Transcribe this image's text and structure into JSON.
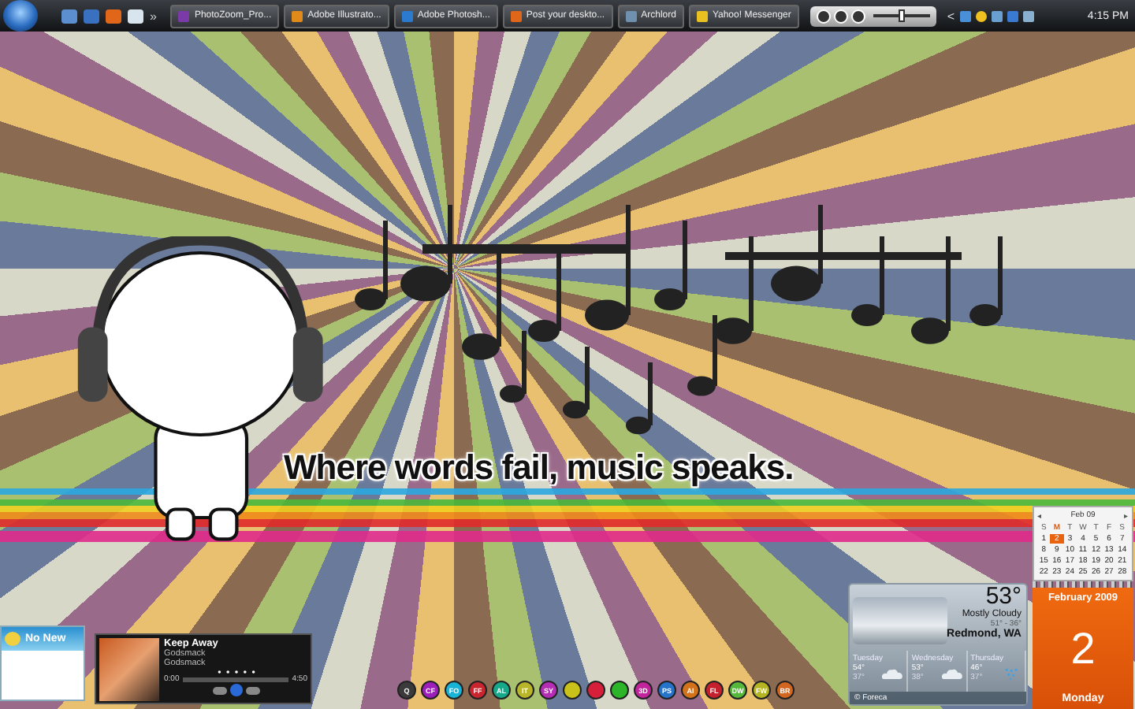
{
  "taskbar": {
    "quick_launch": [
      {
        "kind": "desktop"
      },
      {
        "kind": "switch"
      },
      {
        "kind": "browser"
      },
      {
        "kind": "window"
      }
    ],
    "more": "»",
    "tasks": [
      {
        "label": "PhotoZoom_Pro...",
        "kind": "photozoom",
        "selected": false
      },
      {
        "label": "Adobe Illustrato...",
        "kind": "illustrator",
        "selected": false
      },
      {
        "label": "Adobe Photosh...",
        "kind": "photoshop",
        "selected": false
      },
      {
        "label": "Post your deskto...",
        "kind": "browser",
        "selected": false
      },
      {
        "label": "Archlord",
        "kind": "window",
        "selected": false
      },
      {
        "label": "Yahoo! Messenger",
        "kind": "messenger",
        "selected": false
      }
    ],
    "media_toolbar": {
      "level": 0.5
    },
    "expand": "<",
    "clock": "4:15 PM"
  },
  "wallpaper": {
    "quote": "Where words fail, music speaks."
  },
  "mail_gadget": {
    "status": "No New"
  },
  "media_player": {
    "title": "Keep Away",
    "artist": "Godsmack",
    "album": "Godsmack",
    "elapsed": "0:00",
    "duration": "4:50",
    "level": 0
  },
  "dock": {
    "items": [
      {
        "label": "Q",
        "color": "#3a3a3a"
      },
      {
        "label": "CF",
        "color": "#9b1fb8"
      },
      {
        "label": "FO",
        "color": "#19b3d6"
      },
      {
        "label": "FF",
        "color": "#c9252f"
      },
      {
        "label": "AL",
        "color": "#17a88a"
      },
      {
        "label": "IT",
        "color": "#b9b52a"
      },
      {
        "label": "SY",
        "color": "#b52db4"
      },
      {
        "color": "#c9c21a"
      },
      {
        "color": "#d61f3a"
      },
      {
        "color": "#2db52a"
      },
      {
        "label": "3D",
        "color": "#c2249c"
      },
      {
        "label": "PS",
        "color": "#2674c9"
      },
      {
        "label": "AI",
        "color": "#d2731b"
      },
      {
        "label": "FL",
        "color": "#c4202e"
      },
      {
        "label": "DW",
        "color": "#55b83a"
      },
      {
        "label": "FW",
        "color": "#b5b422"
      },
      {
        "label": "BR",
        "color": "#d2651f"
      }
    ]
  },
  "weather": {
    "temperature": "53°",
    "condition": "Mostly Cloudy",
    "range": "51° - 36°",
    "location": "Redmond, WA",
    "forecast": [
      {
        "day": "Tuesday",
        "high": "54°",
        "low": "37°",
        "kind": "cloudy"
      },
      {
        "day": "Wednesday",
        "high": "53°",
        "low": "38°",
        "kind": "cloudy"
      },
      {
        "day": "Thursday",
        "high": "46°",
        "low": "37°",
        "kind": "rain"
      }
    ],
    "credit": "© Foreca"
  },
  "calendar": {
    "prev": "◂",
    "month": "Feb 09",
    "next": "▸",
    "weekdays": [
      {
        "label": "S",
        "selected": false
      },
      {
        "label": "M",
        "selected": true
      },
      {
        "label": "T",
        "selected": false
      },
      {
        "label": "W",
        "selected": false
      },
      {
        "label": "T",
        "selected": false
      },
      {
        "label": "F",
        "selected": false
      },
      {
        "label": "S",
        "selected": false
      }
    ],
    "weeks": [
      [
        {
          "day": "1",
          "selected": false
        },
        {
          "day": "2",
          "selected": true
        },
        {
          "day": "3",
          "selected": false
        },
        {
          "day": "4",
          "selected": false
        },
        {
          "day": "5",
          "selected": false
        },
        {
          "day": "6",
          "selected": false
        },
        {
          "day": "7",
          "selected": false
        }
      ],
      [
        {
          "day": "8",
          "selected": false
        },
        {
          "day": "9",
          "selected": false
        },
        {
          "day": "10",
          "selected": false
        },
        {
          "day": "11",
          "selected": false
        },
        {
          "day": "12",
          "selected": false
        },
        {
          "day": "13",
          "selected": false
        },
        {
          "day": "14",
          "selected": false
        }
      ],
      [
        {
          "day": "15",
          "selected": false
        },
        {
          "day": "16",
          "selected": false
        },
        {
          "day": "17",
          "selected": false
        },
        {
          "day": "18",
          "selected": false
        },
        {
          "day": "19",
          "selected": false
        },
        {
          "day": "20",
          "selected": false
        },
        {
          "day": "21",
          "selected": false
        }
      ],
      [
        {
          "day": "22",
          "selected": false
        },
        {
          "day": "23",
          "selected": false
        },
        {
          "day": "24",
          "selected": false
        },
        {
          "day": "25",
          "selected": false
        },
        {
          "day": "26",
          "selected": false
        },
        {
          "day": "27",
          "selected": false
        },
        {
          "day": "28",
          "selected": false
        }
      ]
    ],
    "month_year": "February 2009",
    "day": "2",
    "weekday": "Monday"
  }
}
